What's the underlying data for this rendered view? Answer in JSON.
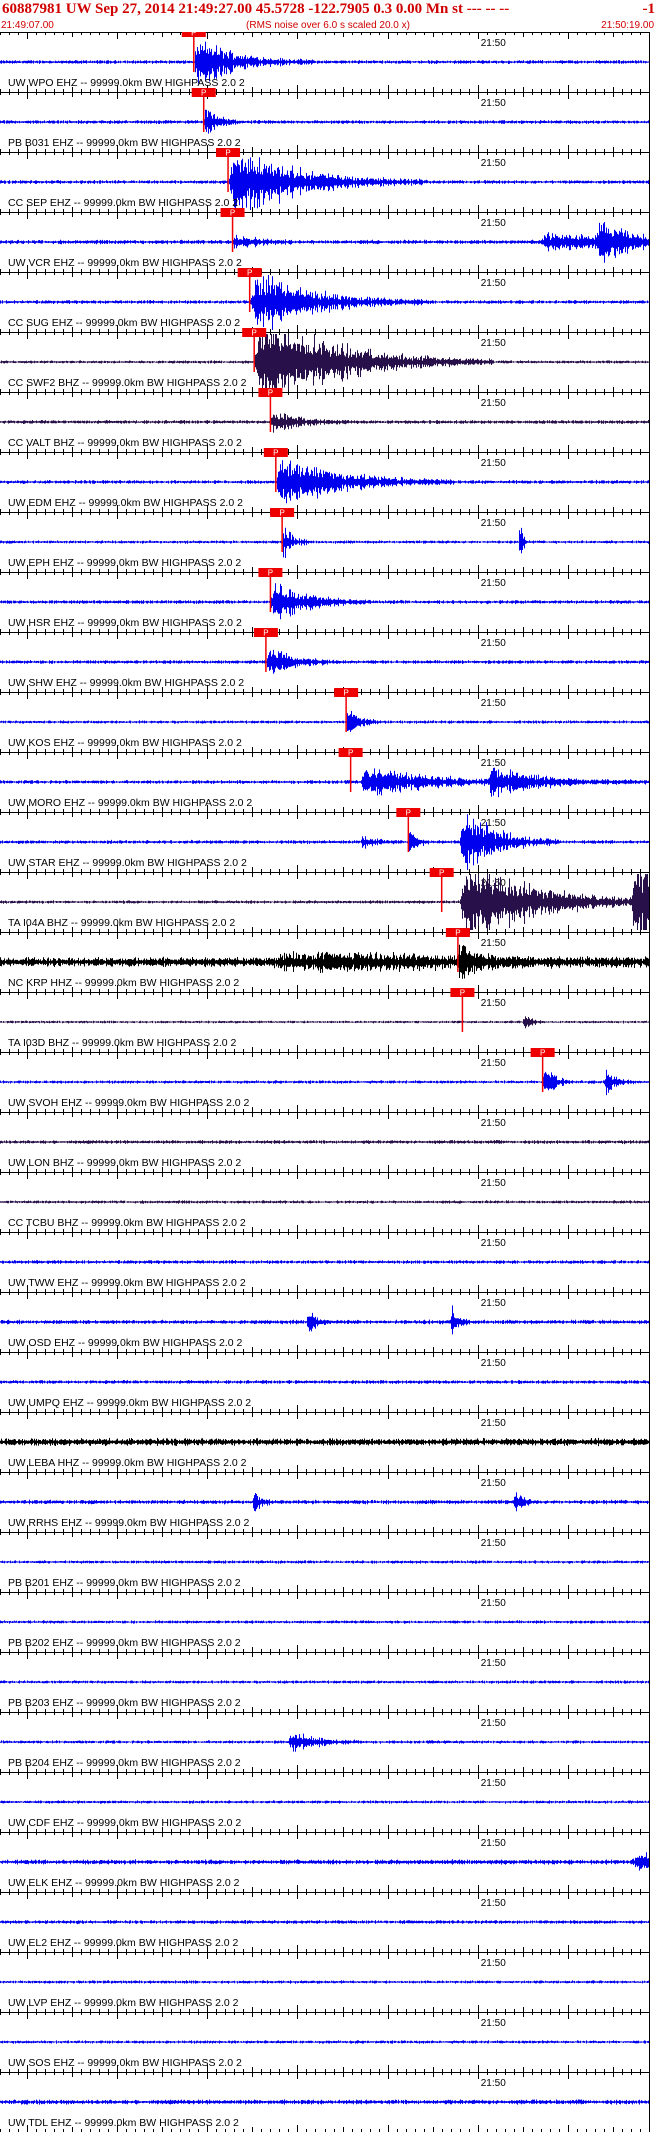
{
  "header": {
    "title": "60887981 UW Sep 27, 2014 21:49:27.00   45.5728 -122.7905  0.3 0.00 Mn st --- -- --",
    "tail": "-1",
    "start_time": "21:49:07.00",
    "end_time": "21:50:19.00",
    "subtitle": "(RMS noise over 6.0 s scaled 20.0 x)"
  },
  "chart_data": {
    "type": "line",
    "x_start": "21:49:07.00",
    "x_end": "21:50:19.00",
    "tick_label": "21:50",
    "pick_label": "P",
    "colors": {
      "blue": "#0000ee",
      "black": "#000000",
      "purple": "#28104a",
      "pick": "#ee0000",
      "axis": "#000000"
    },
    "traces": [
      {
        "label": "UW WPO EHZ -- 99999.0km BW  HIGHPASS  2.0  2",
        "color": "blue",
        "pick": 21.5,
        "events": [
          [
            21.5,
            6,
            3.5
          ]
        ],
        "noise": 0.35
      },
      {
        "label": "PB B031 EHZ -- 99999.0km BW  HIGHPASS  2.0  2",
        "color": "blue",
        "pick": 22.6,
        "events": [
          [
            22.6,
            2,
            2
          ]
        ],
        "noise": 0.35
      },
      {
        "label": "CC SEP EHZ -- 99999.0km BW  HIGHPASS  2.0  2",
        "color": "blue",
        "pick": 25.3,
        "events": [
          [
            25.3,
            10,
            5
          ]
        ],
        "noise": 0.35
      },
      {
        "label": "UW VCR EHZ -- 99999.0km BW  HIGHPASS  2.0  2",
        "color": "blue",
        "pick": 25.8,
        "events": [
          [
            25.8,
            3,
            1.3
          ],
          [
            60,
            10,
            1.4
          ],
          [
            66,
            5,
            2.5
          ]
        ],
        "noise": 0.4
      },
      {
        "label": "CC SUG EHZ -- 99999.0km BW  HIGHPASS  2.0  2",
        "color": "blue",
        "pick": 27.7,
        "events": [
          [
            27.7,
            9,
            4.5
          ]
        ],
        "noise": 0.35
      },
      {
        "label": "CC SWF2 BHZ -- 99999.0km BW  HIGHPASS  2.0  2",
        "color": "purple",
        "pick": 28.2,
        "events": [
          [
            28.2,
            12,
            7
          ]
        ],
        "noise": 0.3
      },
      {
        "label": "CC VALT BHZ -- 99999.0km BW  HIGHPASS  2.0  2",
        "color": "purple",
        "pick": 30.0,
        "events": [
          [
            30,
            4,
            1.5
          ]
        ],
        "noise": 0.35
      },
      {
        "label": "UW EDM EHZ -- 99999.0km BW  HIGHPASS  2.0  2",
        "color": "blue",
        "pick": 30.6,
        "events": [
          [
            30.6,
            9,
            4
          ]
        ],
        "noise": 0.35
      },
      {
        "label": "UW EPH EHZ -- 99999.0km BW  HIGHPASS  2.0  2",
        "color": "blue",
        "pick": 31.3,
        "events": [
          [
            31.3,
            1.5,
            2.5
          ],
          [
            57.5,
            0.4,
            4
          ]
        ],
        "noise": 0.3
      },
      {
        "label": "UW HSR EHZ -- 99999.0km BW  HIGHPASS  2.0  2",
        "color": "blue",
        "pick": 30.0,
        "events": [
          [
            30,
            5,
            3
          ]
        ],
        "noise": 0.35
      },
      {
        "label": "UW SHW EHZ -- 99999.0km BW  HIGHPASS  2.0  2",
        "color": "blue",
        "pick": 29.5,
        "events": [
          [
            29.5,
            4,
            2
          ]
        ],
        "noise": 0.35
      },
      {
        "label": "UW KOS EHZ -- 99999.0km BW  HIGHPASS  2.0  2",
        "color": "blue",
        "pick": 38.4,
        "events": [
          [
            38.4,
            2,
            1.8
          ]
        ],
        "noise": 0.3
      },
      {
        "label": "UW MORO EHZ -- 99999.0km BW  HIGHPASS  2.0  2",
        "color": "blue",
        "pick": 38.9,
        "events": [
          [
            40,
            10,
            2.2
          ],
          [
            54,
            8,
            2
          ]
        ],
        "noise": 0.35
      },
      {
        "label": "UW STAR EHZ -- 99999.0km BW  HIGHPASS  2.0  2",
        "color": "blue",
        "pick": 45.3,
        "events": [
          [
            45.3,
            1,
            3
          ],
          [
            40,
            2,
            1
          ],
          [
            51,
            5,
            5
          ]
        ],
        "noise": 0.35
      },
      {
        "label": "TA I04A BHZ -- 99999.0km BW  HIGHPASS  2.0  2",
        "color": "purple",
        "pick": 49.0,
        "events": [
          [
            51,
            11,
            6
          ],
          [
            70,
            8,
            7
          ]
        ],
        "noise": 0.3
      },
      {
        "label": "NC KRP HHZ -- 99999.0km BW  HIGHPASS  2.0  2",
        "color": "black",
        "pick": 50.8,
        "events": [
          [
            50.8,
            2,
            2.5
          ],
          [
            30,
            30,
            1.1
          ]
        ],
        "noise": 0.9
      },
      {
        "label": "TA I03D BHZ -- 99999.0km BW  HIGHPASS  2.0  2",
        "color": "purple",
        "pick": 51.3,
        "events": [
          [
            58,
            1,
            1.5
          ]
        ],
        "noise": 0.25
      },
      {
        "label": "UW SVOH EHZ -- 99999.0km BW  HIGHPASS  2.0  2",
        "color": "blue",
        "pick": 60.2,
        "events": [
          [
            60.2,
            1.5,
            3
          ],
          [
            67,
            1.5,
            2
          ]
        ],
        "noise": 0.3
      },
      {
        "label": "UW LON BHZ -- 99999.0km BW  HIGHPASS  2.0  2",
        "color": "purple",
        "pick": 80.0,
        "events": [
          [
            80,
            2,
            1.5
          ]
        ],
        "noise": 0.35
      },
      {
        "label": "CC TCBU BHZ -- 99999.0km BW  HIGHPASS  2.0  2",
        "color": "purple",
        "pick": 83.0,
        "events": [
          [
            83,
            2,
            1.5
          ]
        ],
        "noise": 0.3
      },
      {
        "label": "UW TWW EHZ -- 99999.0km BW  HIGHPASS  2.0  2",
        "color": "blue",
        "pick": 92.5,
        "events": [
          [
            94,
            6,
            1.8
          ]
        ],
        "noise": 0.35
      },
      {
        "label": "UW OSD EHZ -- 99999.0km BW  HIGHPASS  2.0  2",
        "color": "blue",
        "pick": 105.0,
        "events": [
          [
            34,
            1,
            3
          ],
          [
            50,
            1,
            2.5
          ],
          [
            105,
            1.5,
            3
          ]
        ],
        "noise": 0.4
      },
      {
        "label": "UW UMPQ EHZ -- 99999.0km BW  HIGHPASS  2.0  2",
        "color": "blue",
        "pick": 107.0,
        "events": [
          [
            107,
            1,
            2
          ]
        ],
        "noise": 0.35
      },
      {
        "label": "UW LEBA HHZ -- 99999.0km BW  HIGHPASS  2.0  2",
        "color": "black",
        "pick": 110.5,
        "events": [
          [
            95,
            10,
            1.6
          ],
          [
            111,
            2,
            4
          ]
        ],
        "noise": 0.7
      },
      {
        "label": "UW RRHS EHZ -- 99999.0km BW  HIGHPASS  2.0  2",
        "color": "blue",
        "pick": 114.0,
        "events": [
          [
            28,
            1,
            2
          ],
          [
            57,
            1,
            2
          ]
        ],
        "noise": 0.4
      },
      {
        "label": "PB B201 EHZ -- 99999.0km BW  HIGHPASS  2.0  2",
        "color": "blue",
        "pick": null,
        "events": [],
        "noise": 0.3
      },
      {
        "label": "PB B202 EHZ -- 99999.0km BW  HIGHPASS  2.0  2",
        "color": "blue",
        "pick": null,
        "events": [],
        "noise": 0.3
      },
      {
        "label": "PB B203 EHZ -- 99999.0km BW  HIGHPASS  2.0  2",
        "color": "blue",
        "pick": null,
        "events": [],
        "noise": 0.3
      },
      {
        "label": "PB B204 EHZ -- 99999.0km BW  HIGHPASS  2.0  2",
        "color": "blue",
        "pick": null,
        "events": [
          [
            32,
            4,
            1.5
          ]
        ],
        "noise": 0.3
      },
      {
        "label": "UW CDF EHZ -- 99999.0km BW  HIGHPASS  2.0  2",
        "color": "blue",
        "pick": null,
        "events": [],
        "noise": 0.3
      },
      {
        "label": "UW ELK EHZ -- 99999.0km BW  HIGHPASS  2.0  2",
        "color": "blue",
        "pick": null,
        "events": [
          [
            70,
            18,
            1.3
          ]
        ],
        "noise": 0.45
      },
      {
        "label": "UW EL2 EHZ -- 99999.0km BW  HIGHPASS  2.0  2",
        "color": "blue",
        "pick": null,
        "events": [],
        "noise": 0.35
      },
      {
        "label": "UW LVP EHZ -- 99999.0km BW  HIGHPASS  2.0  2",
        "color": "blue",
        "pick": null,
        "events": [
          [
            105,
            1,
            1.5
          ]
        ],
        "noise": 0.3
      },
      {
        "label": "UW SOS EHZ -- 99999.0km BW  HIGHPASS  2.0  2",
        "color": "blue",
        "pick": null,
        "events": [],
        "noise": 0.3
      },
      {
        "label": "UW TDL EHZ -- 99999.0km BW  HIGHPASS  2.0  2",
        "color": "blue",
        "pick": null,
        "events": [
          [
            100,
            20,
            1.4
          ]
        ],
        "noise": 0.45
      }
    ]
  }
}
